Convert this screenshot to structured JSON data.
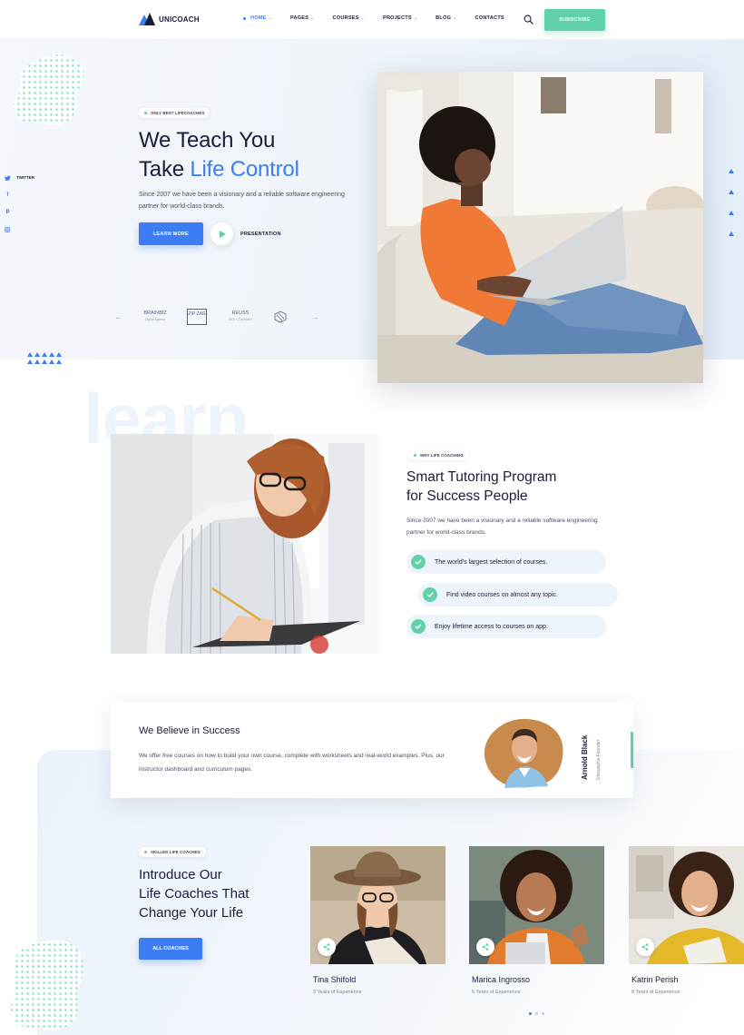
{
  "header": {
    "logo_text": "UNICOACH",
    "nav": [
      {
        "label": "HOME",
        "active": true,
        "has_dropdown": true
      },
      {
        "label": "PAGES",
        "active": false,
        "has_dropdown": true
      },
      {
        "label": "COURSES",
        "active": false,
        "has_dropdown": true
      },
      {
        "label": "PROJECTS",
        "active": false,
        "has_dropdown": true
      },
      {
        "label": "BLOG",
        "active": false,
        "has_dropdown": true
      },
      {
        "label": "CONTACTS",
        "active": false,
        "has_dropdown": false
      }
    ],
    "search_icon": "search-icon",
    "subscribe_label": "SUBSCRIBE"
  },
  "hero": {
    "badge": "ONLY BEST LIFECOACHES",
    "title_line1": "We Teach You",
    "title_line2_plain": "Take ",
    "title_line2_accent": "Life Control",
    "description": "Since 2007 we have been a visionary and a reliable software engineering partner for world-class brands.",
    "learn_more_label": "LEARN MORE",
    "presentation_label": "PRESENTATION",
    "social": [
      {
        "icon": "twitter-icon",
        "label": "TWITTER"
      },
      {
        "icon": "facebook-icon",
        "label": ""
      },
      {
        "icon": "pinterest-icon",
        "label": ""
      },
      {
        "icon": "instagram-icon",
        "label": ""
      }
    ],
    "brands": [
      {
        "name": "BRAINBIZ",
        "sub": "Digital Agency"
      },
      {
        "name": "ZIP ZAG",
        "sub": ""
      },
      {
        "name": "REUSS",
        "sub": "SEO COMPANY"
      },
      {
        "name": "",
        "sub": ""
      }
    ]
  },
  "coaching": {
    "watermark": "learn",
    "badge": "WHY LIFE COACHING",
    "title_line1": "Smart Tutoring Program",
    "title_line2": "for Success People",
    "description": "Since 2007 we have been a visionary and a reliable software engineering partner for world-class brands.",
    "features": [
      "The world's largest selection of courses.",
      "Find video courses on almost any topic.",
      "Enjoy lifetime access to courses on  app."
    ]
  },
  "belief": {
    "title": "We Believe in Success",
    "text": "We offer free courses on how to build your own course, complete with worksheets and real-world examples. Plus, our instructor dashboard and curriculum pages.",
    "founder_name": "Arnold Black",
    "founder_role": "Unicoach's Founder"
  },
  "coaches": {
    "badge": "SKILLED LIFE COACHES",
    "title_line1": "Introduce Our",
    "title_line2": "Life Coaches That",
    "title_line3": "Change Your Life",
    "button_label": "ALL COACHES",
    "items": [
      {
        "name": "Tina Shifold",
        "experience": "3 Years of Experience"
      },
      {
        "name": "Marica Ingrosso",
        "experience": "5 Years of Experience"
      },
      {
        "name": "Katrin Perish",
        "experience": "8 Years of Experience"
      }
    ]
  },
  "colors": {
    "accent_blue": "#3d7df3",
    "accent_green": "#62d0a8",
    "text_dark": "#1b1d3a"
  }
}
